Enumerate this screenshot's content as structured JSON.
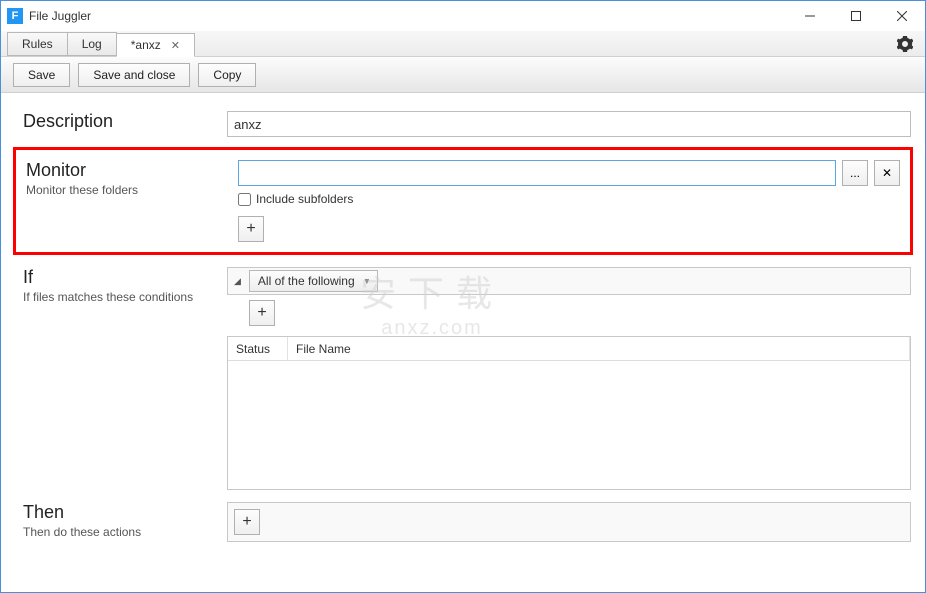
{
  "window": {
    "app_icon_letter": "F",
    "title": "File Juggler"
  },
  "tabs": {
    "rules": "Rules",
    "log": "Log",
    "active": "*anxz"
  },
  "toolbar": {
    "save": "Save",
    "save_close": "Save and close",
    "copy": "Copy"
  },
  "description": {
    "heading": "Description",
    "value": "anxz"
  },
  "monitor": {
    "heading": "Monitor",
    "subtitle": "Monitor these folders",
    "path_value": "",
    "browse_label": "...",
    "remove_label": "✕",
    "include_subfolders_label": "Include subfolders",
    "include_subfolders_checked": false,
    "add_label": "+"
  },
  "if_section": {
    "heading": "If",
    "subtitle": "If files matches these conditions",
    "condition_mode": "All of the following",
    "add_label": "+",
    "table": {
      "col_status": "Status",
      "col_file": "File Name"
    }
  },
  "then_section": {
    "heading": "Then",
    "subtitle": "Then do these actions",
    "add_label": "+"
  },
  "watermark": {
    "line1": "安下载",
    "line2": "anxz.com"
  }
}
